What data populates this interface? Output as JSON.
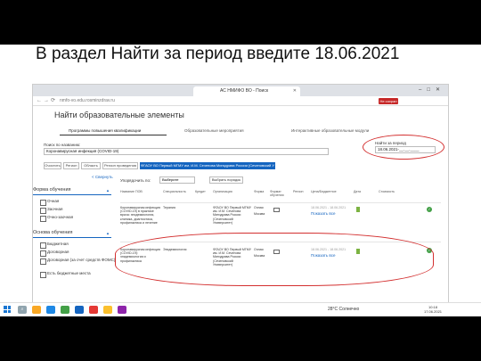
{
  "slide": {
    "title": "В раздел Найти за период введите 18.06.2021"
  },
  "browser": {
    "tab_title": "АС НМИФО ВО - Поиск",
    "url": "nmfo-vo.edu.rosminzdrav.ru",
    "extension_label": "Не сохран"
  },
  "page": {
    "title": "Найти образовательные элементы",
    "program_tabs": [
      "Программы повышения квалификации",
      "Образовательные мероприятия",
      "Интерактивные образовательные модули"
    ],
    "search_label": "Поиск по названию:",
    "search_value": "Коронавирусная инфекция (COVID-19)",
    "period_label": "Найти за период",
    "period_value": "18.06.2021-__.__.____",
    "filter_buttons": [
      "Очистить",
      "Регион",
      "Область",
      "Регион проведения"
    ],
    "filter_org": "ФГАОУ ВО Первый МГМУ им. И.М. Сеченова Минздрава России (Сеченовский Университет)",
    "collapse": "< Свернуть",
    "form_h": "Форма обучения",
    "form_items": [
      "Очная",
      "Заочная",
      "Очно-заочная"
    ],
    "basis_h": "Основа обучения",
    "basis_items": [
      "Бюджетная",
      "Договорная",
      "Договорная (за счет средств ФОМС)",
      "Есть бюджетные места"
    ],
    "order_label": "Упорядочить по:",
    "order_value": "Выберите",
    "order_btn": "Выбрать порядок",
    "headers": [
      "Название ПОВ",
      "Специальность",
      "Кредит",
      "Организация",
      "Форма",
      "Формат обучения",
      "Регион",
      "Цена/Бюджетное",
      "Дата",
      "Стоимость"
    ],
    "rows": [
      {
        "name": "Коронавирусная инфекция (COVID-19) в практике врача: эпидемиология, клиника, диагностика, профилактика и лечение",
        "specialty": "Терапия",
        "org": "ФГАОУ ВО Первый МГМУ им. И.М. Сеченова Минздрава России (Сеченовский Университет)",
        "form": "Очная",
        "region": "Москва",
        "date": "18.06.2021 - 18.06.2021",
        "show_all": "Показать все"
      },
      {
        "name": "Коронавирусная инфекция (COVID-19): эпидемиология и профилактика",
        "specialty": "Эпидемиология",
        "org": "ФГАОУ ВО Первый МГМУ им. И.М. Сеченова Минздрава России (Сеченовский Университет)",
        "form": "Очная",
        "region": "Москва",
        "date": "18.06.2021 - 18.06.2021",
        "show_all": "Показать все"
      }
    ],
    "pager_label": "Показывать по:",
    "pager_options": [
      "10",
      "20",
      "50"
    ]
  },
  "taskbar": {
    "weather": "28°C Солнечно",
    "time": "10:18",
    "date": "17.06.2021"
  }
}
